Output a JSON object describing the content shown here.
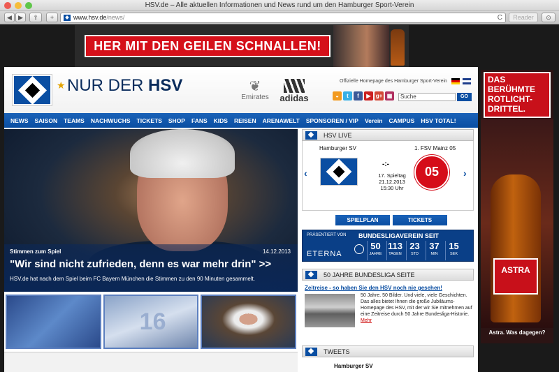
{
  "window": {
    "title": "HSV.de – Alle aktuellen Informationen und News rund um den Hamburger Sport-Verein",
    "url_host": "www.hsv.de",
    "url_path": "/news/",
    "reader": "Reader",
    "reload": "C"
  },
  "top_ad": {
    "text": "HER MIT DEN GEILEN SCHNALLEN!"
  },
  "header": {
    "star": "★",
    "brand_prefix": "NUR DER ",
    "brand_bold": "HSV",
    "sponsor1": "Emirates",
    "sponsor2": "adidas",
    "official": "Offizielle Homepage des Hamburger Sport-Verein",
    "search_value": "Suche",
    "search_button": "GO"
  },
  "social": [
    {
      "icon": "rss-icon",
      "glyph": "◒",
      "color": "#f29a1f"
    },
    {
      "icon": "twitter-icon",
      "glyph": "t",
      "color": "#37b0e6"
    },
    {
      "icon": "facebook-icon",
      "glyph": "f",
      "color": "#3b5998"
    },
    {
      "icon": "youtube-icon",
      "glyph": "▶",
      "color": "#cc2020"
    },
    {
      "icon": "google-plus-icon",
      "glyph": "g+",
      "color": "#d34836"
    },
    {
      "icon": "grid-icon",
      "glyph": "▦",
      "color": "#b03060"
    },
    {
      "icon": "instagram-icon",
      "glyph": "◉",
      "color": "#6b4a3a"
    }
  ],
  "nav": [
    "NEWS",
    "SAISON",
    "TEAMS",
    "NACHWUCHS",
    "TICKETS",
    "SHOP",
    "FANS",
    "KIDS",
    "REISEN",
    "ARENAWELT",
    "SPONSOREN / VIP",
    "Verein",
    "CAMPUS",
    "HSV TOTAL!"
  ],
  "hero": {
    "kicker": "Stimmen zum Spiel",
    "date": "14.12.2013",
    "headline": "\"Wir sind nicht zufrieden, denn es war mehr drin\" >>",
    "teaser": "HSV.de hat nach dem Spiel beim FC Bayern München die Stimmen zu den 90 Minuten gesammelt.",
    "thumb2_number": "16"
  },
  "live": {
    "title": "HSV LIVE",
    "home": "Hamburger SV",
    "away": "1. FSV Mainz 05",
    "away_badge": "05",
    "score": "-:-",
    "matchday": "17. Spieltag",
    "date": "21.12.2013",
    "time": "15:30 Uhr",
    "prev": "‹",
    "next": "›",
    "btn_plan": "SPIELPLAN",
    "btn_tickets": "TICKETS"
  },
  "bundesliga": {
    "presented": "PRÄSENTIERT VON",
    "sponsor": "ETERNA",
    "title": "BUNDESLIGAVEREIN SEIT",
    "counters": [
      {
        "value": "50",
        "unit": "JAHRE"
      },
      {
        "value": "113",
        "unit": "TAGEN"
      },
      {
        "value": "23",
        "unit": "STD"
      },
      {
        "value": "37",
        "unit": "MIN"
      },
      {
        "value": "15",
        "unit": "SEK"
      }
    ]
  },
  "years50": {
    "title": "50 JAHRE BUNDESLIGA SEITE",
    "link": "Zeitreise - so haben Sie den HSV noch nie gesehen!",
    "text": "50 Jahre. 50 Bilder. Und viele, viele Geschichten. Das alles bietet Ihnen die große Jubiläums-Homepage des HSV, mit der wir Sie mitnehmen auf eine Zeitreise durch 50 Jahre Bundesliga-Historie.",
    "more": "Mehr"
  },
  "tweets": {
    "title": "TWEETS",
    "user": "Hamburger SV"
  },
  "right_ad": {
    "text": "DAS BERÜHMTE ROTLICHT-DRITTEL.",
    "label": "ASTRA",
    "footer": "Astra. Was dagegen?"
  }
}
